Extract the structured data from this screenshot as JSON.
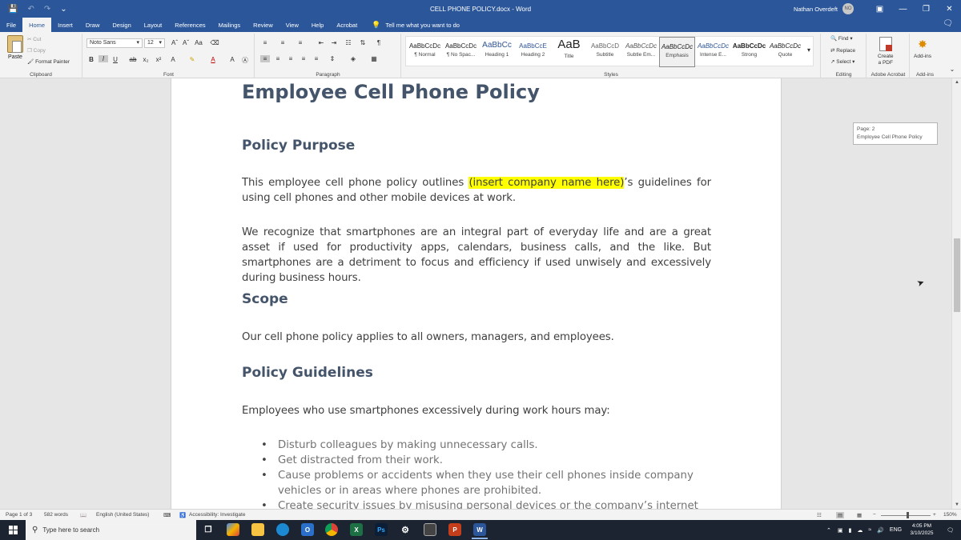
{
  "window": {
    "title": "CELL PHONE POLICY.docx  -  Word",
    "user_name": "Nathan Overdeft",
    "user_initials": "NO"
  },
  "menu": {
    "tabs": [
      "File",
      "Home",
      "Insert",
      "Draw",
      "Design",
      "Layout",
      "References",
      "Mailings",
      "Review",
      "View",
      "Help",
      "Acrobat"
    ],
    "active_tab": "Home",
    "tell_me": "Tell me what you want to do"
  },
  "ribbon": {
    "clipboard": {
      "paste": "Paste",
      "cut": "Cut",
      "copy": "Copy",
      "format_painter": "Format Painter",
      "label": "Clipboard"
    },
    "font": {
      "family": "Noto Sans",
      "size": "12",
      "label": "Font"
    },
    "paragraph": {
      "label": "Paragraph"
    },
    "styles": {
      "label": "Styles",
      "items": [
        {
          "sample": "AaBbCcDc",
          "name": "¶ Normal"
        },
        {
          "sample": "AaBbCcDc",
          "name": "¶ No Spac..."
        },
        {
          "sample": "AaBbCc",
          "name": "Heading 1"
        },
        {
          "sample": "AaBbCcE",
          "name": "Heading 2"
        },
        {
          "sample": "AaB",
          "name": "Title"
        },
        {
          "sample": "AaBbCcD",
          "name": "Subtitle"
        },
        {
          "sample": "AaBbCcDc",
          "name": "Subtle Em..."
        },
        {
          "sample": "AaBbCcDc",
          "name": "Emphasis"
        },
        {
          "sample": "AaBbCcDc",
          "name": "Intense E..."
        },
        {
          "sample": "AaBbCcDc",
          "name": "Strong"
        },
        {
          "sample": "AaBbCcDc",
          "name": "Quote"
        }
      ]
    },
    "editing": {
      "find": "Find",
      "replace": "Replace",
      "select": "Select",
      "label": "Editing"
    },
    "acrobat": {
      "create_pdf_line1": "Create",
      "create_pdf_line2": "a PDF",
      "label": "Adobe Acrobat"
    },
    "addins": {
      "button": "Add-ins",
      "label": "Add-ins"
    }
  },
  "document": {
    "title": "Employee Cell Phone Policy",
    "h_purpose": "Policy Purpose",
    "p1_before": "This employee cell phone policy outlines ",
    "p1_highlight": "(insert company name here)",
    "p1_after": "’s guidelines for using cell phones and other mobile devices at work.",
    "p2": "We recognize that smartphones are an integral part of everyday life and are a great asset if used for productivity apps, calendars, business calls, and the like. But smartphones are a detriment to focus and efficiency if used unwisely and excessively during business hours.",
    "h_scope": "Scope",
    "p_scope": "Our cell phone policy applies to all owners, managers, and employees.",
    "h_guidelines": "Policy Guidelines",
    "p_guidelines": "Employees who use smartphones excessively during work hours may:",
    "bullets": [
      "Disturb colleagues by making unnecessary calls.",
      "Get distracted from their work.",
      "Cause problems or accidents when they use their cell phones inside company vehicles or in areas where phones are prohibited.",
      "Create security issues by misusing personal devices or the company’s internet"
    ]
  },
  "page_tooltip": {
    "line1": "Page: 2",
    "line2": "Employee Cell Phone Policy"
  },
  "status": {
    "page": "Page 1 of 3",
    "words": "582 words",
    "language": "English (United States)",
    "accessibility": "Accessibility: Investigate",
    "zoom": "150%"
  },
  "taskbar": {
    "search_placeholder": "Type here to search",
    "language": "ENG",
    "time": "4:05 PM",
    "date": "3/10/2025"
  }
}
